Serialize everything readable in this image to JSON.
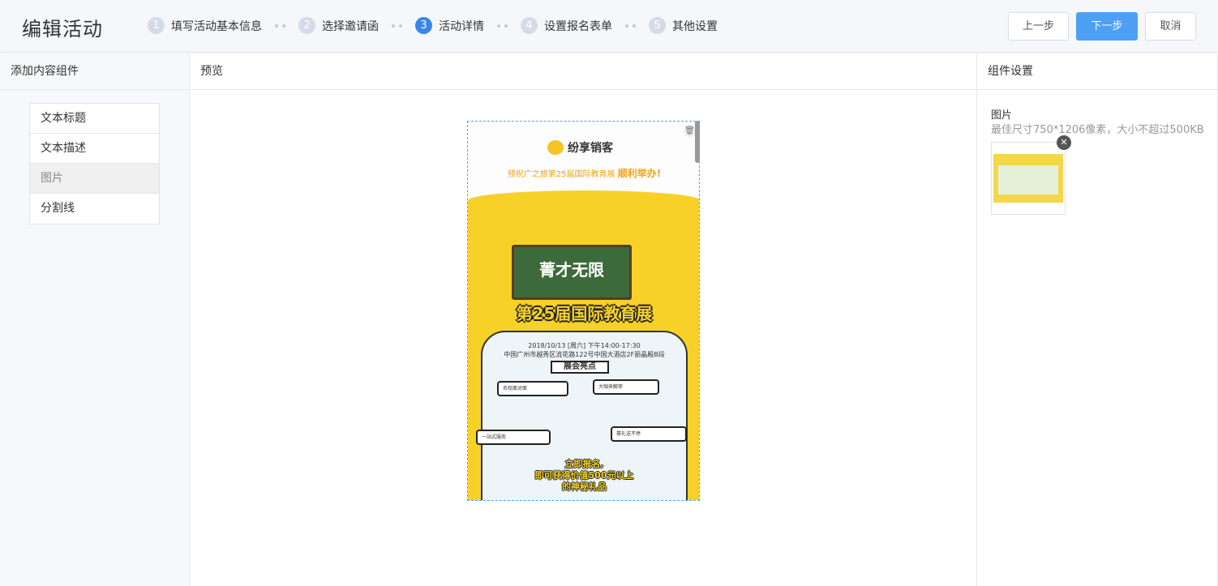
{
  "header": {
    "title": "编辑活动",
    "steps": [
      {
        "num": "1",
        "label": "填写活动基本信息"
      },
      {
        "num": "2",
        "label": "选择邀请函"
      },
      {
        "num": "3",
        "label": "活动详情"
      },
      {
        "num": "4",
        "label": "设置报名表单"
      },
      {
        "num": "5",
        "label": "其他设置"
      }
    ],
    "active_step": 3,
    "prev_label": "上一步",
    "next_label": "下一步",
    "cancel_label": "取消"
  },
  "left": {
    "heading": "添加内容组件",
    "components": [
      "文本标题",
      "文本描述",
      "图片",
      "分割线"
    ],
    "selected": "图片"
  },
  "middle": {
    "heading": "预览",
    "poster": {
      "brand": "纷享销客",
      "congrats_prefix": "预祝广之旅第25届国际教育展",
      "congrats_emph": "顺利举办!",
      "board_title": "菁才无限",
      "headline": "第25届国际教育展",
      "date_line": "2018/10/13 [周六] 下午14:00-17:30",
      "address_line": "中国广州市越秀区流花路122号中国大酒店2F丽晶殿B段",
      "highlight": "展会亮点",
      "bubbles": [
        "名校面对面",
        "大咖来解密",
        "一站式服务",
        "豪礼送不停"
      ],
      "cta_line1": "立即报名,",
      "cta_line2": "即可获得价值500元以上",
      "cta_line3": "的神秘礼品"
    }
  },
  "right": {
    "heading": "组件设置",
    "setting_title": "图片",
    "setting_hint": "最佳尺寸750*1206像素，大小不超过500KB"
  },
  "colors": {
    "accent": "#4ea0f5",
    "step_active": "#3a86e8",
    "step_inactive": "#d5dbe6",
    "poster_yellow": "#f7d128"
  }
}
